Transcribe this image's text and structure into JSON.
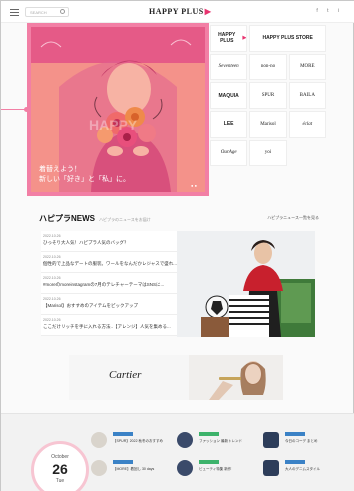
{
  "header": {
    "search_placeholder": "SEARCH",
    "logo": "HAPPY PLUS",
    "social": "f  t  i"
  },
  "hero": {
    "caption_line1": "着替えよう！",
    "caption_line2": "新しい「好き」と「私」に。",
    "watermark": "HAPPY"
  },
  "brands": [
    {
      "name": "HAPPY PLUS",
      "wide": false
    },
    {
      "name": "HAPPY PLUS STORE",
      "wide": true
    },
    {
      "name": "Seventeen",
      "wide": false,
      "script": true
    },
    {
      "name": "non-no",
      "wide": false
    },
    {
      "name": "MORE",
      "wide": false
    },
    {
      "name": "MAQUIA",
      "wide": false,
      "bold": true
    },
    {
      "name": "SPUR",
      "wide": false
    },
    {
      "name": "BAILA",
      "wide": false
    },
    {
      "name": "LEE",
      "wide": false,
      "bold": true
    },
    {
      "name": "Marisol",
      "wide": false
    },
    {
      "name": "éclat",
      "wide": false,
      "script": true
    },
    {
      "name": "OurAge",
      "wide": false,
      "script": true
    },
    {
      "name": "yoi",
      "wide": false
    }
  ],
  "news": {
    "title": "ハピプラNEWS",
    "subtitle": "ハピプラのニュースをお届け",
    "more_link": "ハピプラニュース一覧を見る",
    "items": [
      {
        "meta": "2022.10.26",
        "text": "ひっそり大人気！ハピプラ人気のバッグ？"
      },
      {
        "meta": "2022.10.26",
        "text": "個性的で上品なデートの服装。ワールをなんだかレジャスで盛れ..."
      },
      {
        "meta": "2022.10.26",
        "text": "#moreのmoreinstagramの7月のテレチャーテーマはSNSに..."
      },
      {
        "meta": "2022.10.26",
        "text": "【Marisol】おすすめのアイテムをピックアップ"
      },
      {
        "meta": "2022.10.26",
        "text": "ここだけリッチを手に入れる方法..【アレンジ】人気を集める..."
      }
    ]
  },
  "ad": {
    "brand": "Cartier"
  },
  "calendar": {
    "month": "October",
    "day": "26",
    "weekday": "Tue"
  },
  "mini_items": [
    {
      "line": "【SPUR】2022 秋冬のおすすめ",
      "tag": "blue"
    },
    {
      "line": "ファッション 最新トレンド",
      "tag": "green"
    },
    {
      "line": "今日のコーデ まとめ",
      "tag": "blue"
    },
    {
      "line": "【MORE】着回し 30 days",
      "tag": "blue"
    },
    {
      "line": "ビューティ特集 新作",
      "tag": "green"
    },
    {
      "line": "大人のデニムスタイル",
      "tag": "blue"
    }
  ]
}
